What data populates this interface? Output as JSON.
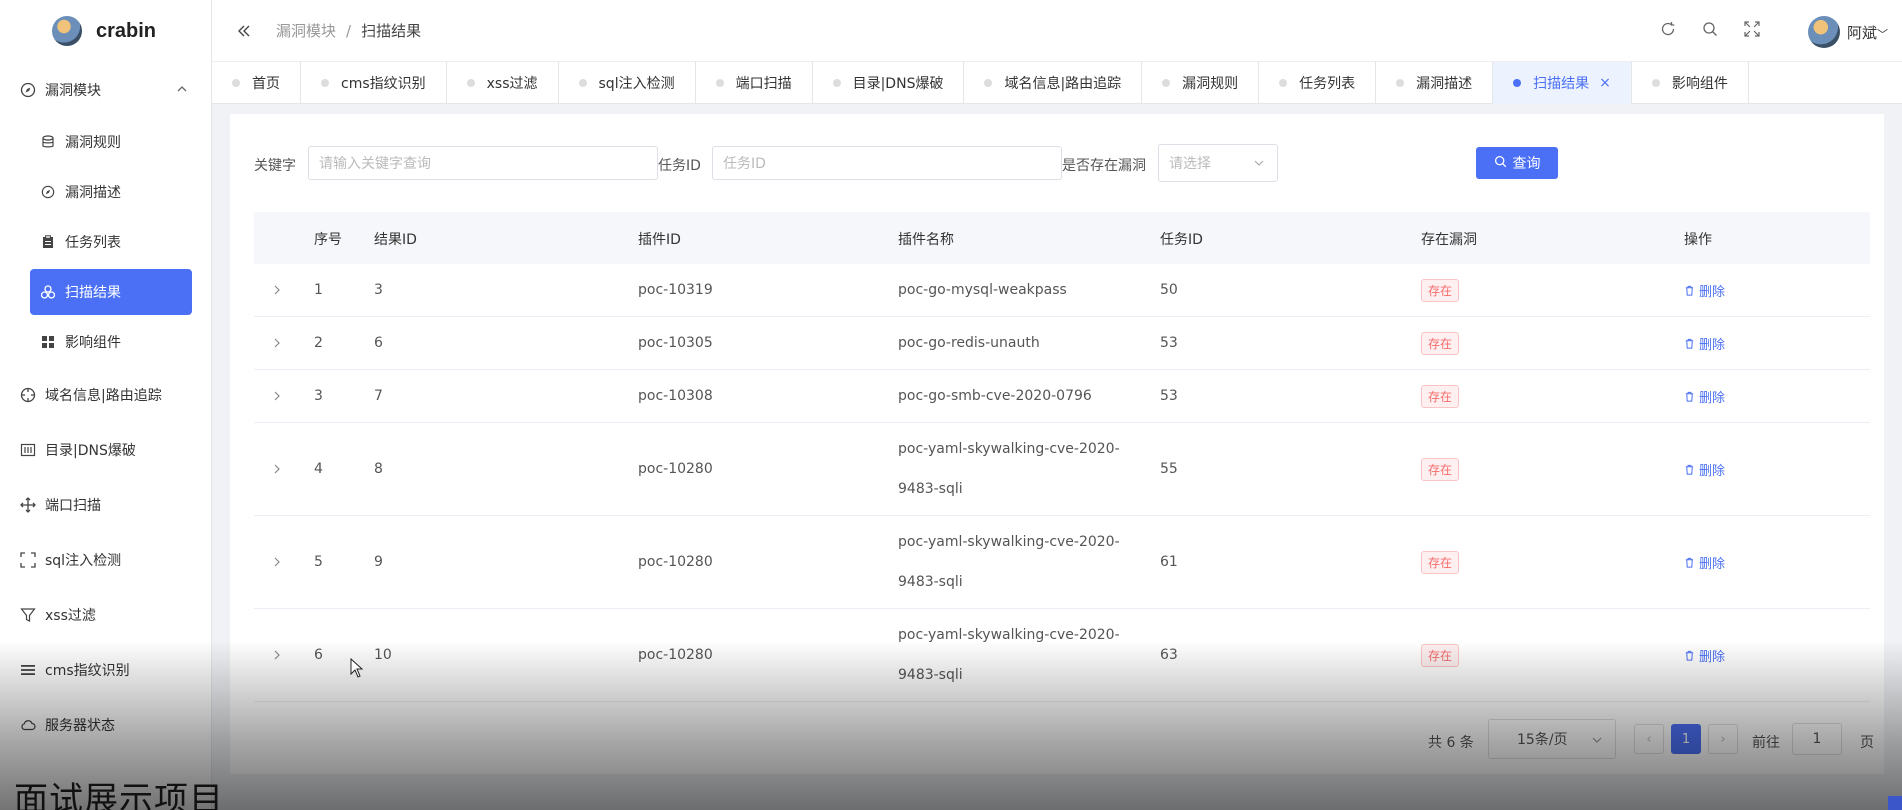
{
  "app": {
    "name": "crabin"
  },
  "colors": {
    "primary": "#4b70f5",
    "danger": "#f56c6c",
    "sidebar_active": "#4b70f5"
  },
  "header": {
    "breadcrumb": [
      "漏洞模块",
      "扫描结果"
    ],
    "user": "阿斌",
    "icons": [
      "refresh-icon",
      "search-icon",
      "fullscreen-icon"
    ]
  },
  "sidebar": {
    "group": {
      "label": "漏洞模块",
      "icon": "compass-icon"
    },
    "sub_items": [
      {
        "label": "漏洞规则",
        "icon": "database-icon"
      },
      {
        "label": "漏洞描述",
        "icon": "compass-icon"
      },
      {
        "label": "任务列表",
        "icon": "clipboard-icon"
      },
      {
        "label": "扫描结果",
        "icon": "scan-icon",
        "active": true
      },
      {
        "label": "影响组件",
        "icon": "grid-icon"
      }
    ],
    "items": [
      {
        "label": "域名信息|路由追踪",
        "icon": "target-icon"
      },
      {
        "label": "目录|DNS爆破",
        "icon": "barcode-icon"
      },
      {
        "label": "端口扫描",
        "icon": "move-icon"
      },
      {
        "label": "sql注入检测",
        "icon": "scan-frame-icon"
      },
      {
        "label": "xss过滤",
        "icon": "filter-icon"
      },
      {
        "label": "cms指纹识别",
        "icon": "menu-icon"
      },
      {
        "label": "服务器状态",
        "icon": "cloud-icon"
      }
    ]
  },
  "tabs": [
    {
      "label": "首页"
    },
    {
      "label": "cms指纹识别"
    },
    {
      "label": "xss过滤"
    },
    {
      "label": "sql注入检测"
    },
    {
      "label": "端口扫描"
    },
    {
      "label": "目录|DNS爆破"
    },
    {
      "label": "域名信息|路由追踪"
    },
    {
      "label": "漏洞规则"
    },
    {
      "label": "任务列表"
    },
    {
      "label": "漏洞描述"
    },
    {
      "label": "扫描结果",
      "active": true,
      "close": "×"
    },
    {
      "label": "影响组件"
    }
  ],
  "search": {
    "keyword_label": "关键字",
    "keyword_placeholder": "请输入关键字查询",
    "task_label": "任务ID",
    "task_placeholder": "任务ID",
    "vuln_label": "是否存在漏洞",
    "vuln_placeholder": "请选择",
    "query_button": "查询"
  },
  "table": {
    "headers": [
      "序号",
      "结果ID",
      "插件ID",
      "插件名称",
      "任务ID",
      "存在漏洞",
      "操作"
    ],
    "rows": [
      {
        "idx": "1",
        "rid": "3",
        "pid": "poc-10319",
        "pname": "poc-go-mysql-weakpass",
        "tid": "50",
        "vuln": "存在",
        "op": "删除"
      },
      {
        "idx": "2",
        "rid": "6",
        "pid": "poc-10305",
        "pname": "poc-go-redis-unauth",
        "tid": "53",
        "vuln": "存在",
        "op": "删除"
      },
      {
        "idx": "3",
        "rid": "7",
        "pid": "poc-10308",
        "pname": "poc-go-smb-cve-2020-0796",
        "tid": "53",
        "vuln": "存在",
        "op": "删除"
      },
      {
        "idx": "4",
        "rid": "8",
        "pid": "poc-10280",
        "pname": "poc-yaml-skywalking-cve-2020-9483-sqli",
        "tid": "55",
        "vuln": "存在",
        "op": "删除"
      },
      {
        "idx": "5",
        "rid": "9",
        "pid": "poc-10280",
        "pname": "poc-yaml-skywalking-cve-2020-9483-sqli",
        "tid": "61",
        "vuln": "存在",
        "op": "删除"
      },
      {
        "idx": "6",
        "rid": "10",
        "pid": "poc-10280",
        "pname": "poc-yaml-skywalking-cve-2020-9483-sqli",
        "tid": "63",
        "vuln": "存在",
        "op": "删除"
      }
    ]
  },
  "pagination": {
    "total": "共 6 条",
    "page_size": "15条/页",
    "prev": "‹",
    "current": "1",
    "next": "›",
    "goto_label": "前往",
    "goto_value": "1",
    "page_label": "页"
  },
  "overlay": {
    "caption": "面试展示项目"
  }
}
